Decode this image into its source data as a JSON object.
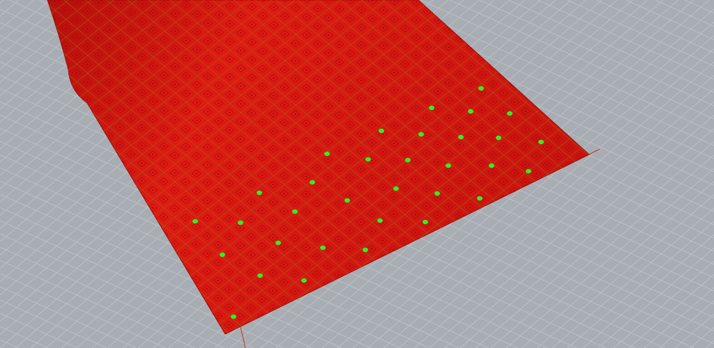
{
  "viewport": {
    "background_color": "#a8adb3",
    "grid_color": "#bcc0c5",
    "surface_color": "#d0140f",
    "panel_line_color": "#8c6a1c",
    "highlight_color": "#33ee22",
    "axis_color": "#c0302a"
  }
}
